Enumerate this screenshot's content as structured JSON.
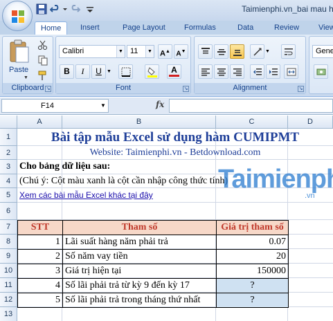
{
  "window": {
    "title": "Taimienphi.vn_bai mau h"
  },
  "ribbon_tabs": [
    "Home",
    "Insert",
    "Page Layout",
    "Formulas",
    "Data",
    "Review",
    "View"
  ],
  "ribbon": {
    "clipboard": {
      "label": "Clipboard",
      "paste_label": "Paste"
    },
    "font": {
      "label": "Font",
      "font_name": "Calibri",
      "font_size": "11",
      "bold": "B",
      "italic": "I",
      "underline": "U"
    },
    "alignment": {
      "label": "Alignment"
    },
    "number": {
      "format": "Gene"
    }
  },
  "formula_bar": {
    "name_box": "F14",
    "fx_label": "fx",
    "formula": ""
  },
  "columns": [
    "A",
    "B",
    "C",
    "D"
  ],
  "rows": [
    "1",
    "2",
    "3",
    "4",
    "5",
    "6",
    "7",
    "8",
    "9",
    "10",
    "11",
    "12",
    "13"
  ],
  "sheet": {
    "title": "Bài tập mẫu Excel sử dụng hàm CUMIPMT",
    "website": "Website: Taimienphi.vn - Betdownload.com",
    "prompt": "Cho bảng dữ liệu sau:",
    "note": "(Chú ý: Cột màu xanh là cột cần nhập công thức tính)",
    "link": "Xem các bài mẫu Excel khác tại đây",
    "table": {
      "headers": [
        "STT",
        "Tham số",
        "Giá trị tham số"
      ],
      "rows": [
        {
          "stt": "1",
          "param": "Lãi suất hàng năm phải trả",
          "value": "0.07"
        },
        {
          "stt": "2",
          "param": "Số năm vay tiền",
          "value": "20"
        },
        {
          "stt": "3",
          "param": "Giá trị hiện tại",
          "value": "150000"
        },
        {
          "stt": "4",
          "param": "Số lãi phải trả từ kỳ 9 đến kỳ 17",
          "value": "?"
        },
        {
          "stt": "5",
          "param": "Số lãi phải trả trong tháng thứ nhất",
          "value": "?"
        }
      ]
    }
  },
  "watermark": {
    "text": "Taimienphi",
    "sub": ".vn"
  },
  "colors": {
    "title_blue": "#1f3f99",
    "header_red": "#c0392b",
    "header_fill": "#f7d8c8",
    "formula_fill": "#cfe1f2",
    "link": "#1a0dab"
  }
}
